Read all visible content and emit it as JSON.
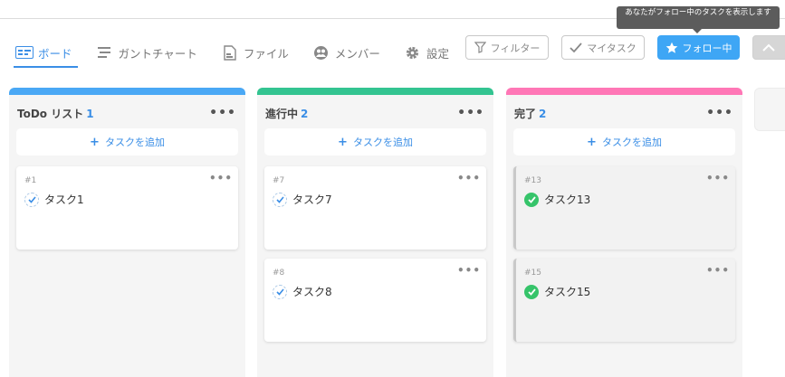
{
  "tabs": [
    {
      "label": "ボード",
      "icon": "board-icon",
      "active": true
    },
    {
      "label": "ガントチャート",
      "icon": "gantt-icon"
    },
    {
      "label": "ファイル",
      "icon": "file-icon"
    },
    {
      "label": "メンバー",
      "icon": "members-icon"
    },
    {
      "label": "設定",
      "icon": "gear-icon"
    }
  ],
  "toolbar": {
    "filter_label": "フィルター",
    "mytask_label": "マイタスク",
    "follow_label": "フォロー中",
    "tooltip": "あなたがフォロー中のタスクを表示します"
  },
  "colors": {
    "accent": "#3a8ee6",
    "todo": "#4aa8f5",
    "progress": "#33c491",
    "done": "#ff77b6",
    "follow": "#3ea6f5",
    "check": "#36c46a"
  },
  "columns": [
    {
      "title": "ToDo リスト",
      "count": "1",
      "add_label": "タスクを追加",
      "cards": [
        {
          "num": "#1",
          "name": "タスク1",
          "done": false
        }
      ]
    },
    {
      "title": "進行中",
      "count": "2",
      "add_label": "タスクを追加",
      "cards": [
        {
          "num": "#7",
          "name": "タスク7",
          "done": false
        },
        {
          "num": "#8",
          "name": "タスク8",
          "done": false
        }
      ]
    },
    {
      "title": "完了",
      "count": "2",
      "add_label": "タスクを追加",
      "cards": [
        {
          "num": "#13",
          "name": "タスク13",
          "done": true
        },
        {
          "num": "#15",
          "name": "タスク15",
          "done": true
        }
      ]
    }
  ]
}
